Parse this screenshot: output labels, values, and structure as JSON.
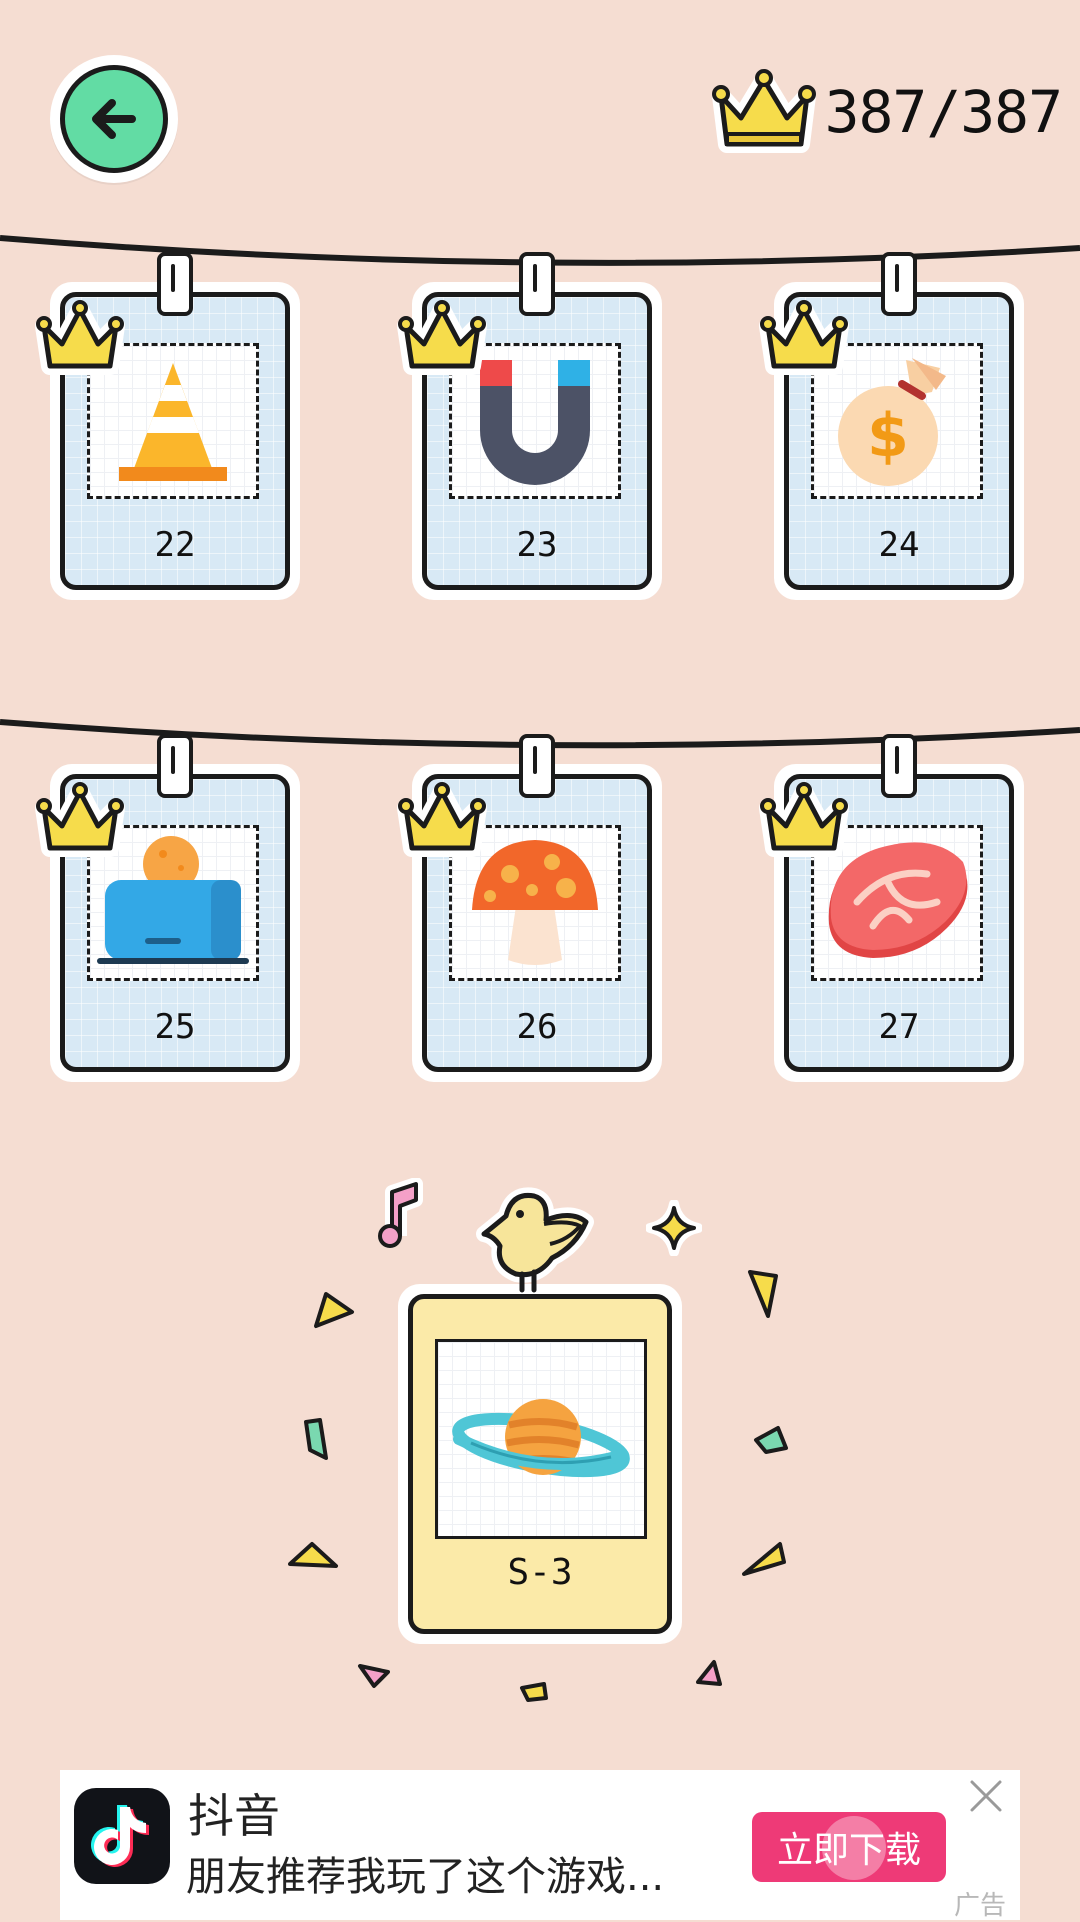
{
  "header": {
    "crown_count": "387/387"
  },
  "cards": [
    {
      "label": "22",
      "icon": "traffic-cone-icon",
      "crowned": true
    },
    {
      "label": "23",
      "icon": "magnet-icon",
      "crowned": true
    },
    {
      "label": "24",
      "icon": "money-bag-icon",
      "crowned": true
    },
    {
      "label": "25",
      "icon": "toaster-icon",
      "crowned": true
    },
    {
      "label": "26",
      "icon": "mushroom-icon",
      "crowned": true
    },
    {
      "label": "27",
      "icon": "steak-icon",
      "crowned": true
    }
  ],
  "special_card": {
    "label": "S-3",
    "icon": "saturn-planet-icon",
    "mascot": "bird-icon"
  },
  "ad": {
    "app_name": "抖音",
    "description": "朋友推荐我玩了这个游戏...",
    "button_label": "立即下载",
    "tag": "广告"
  },
  "colors": {
    "background": "#f5ddd2",
    "back_button": "#62dca4",
    "card_frame": "#d8e9f5",
    "special_frame": "#fbeaa8",
    "crown": "#f6dc4b",
    "ad_button": "#ee3a77"
  }
}
